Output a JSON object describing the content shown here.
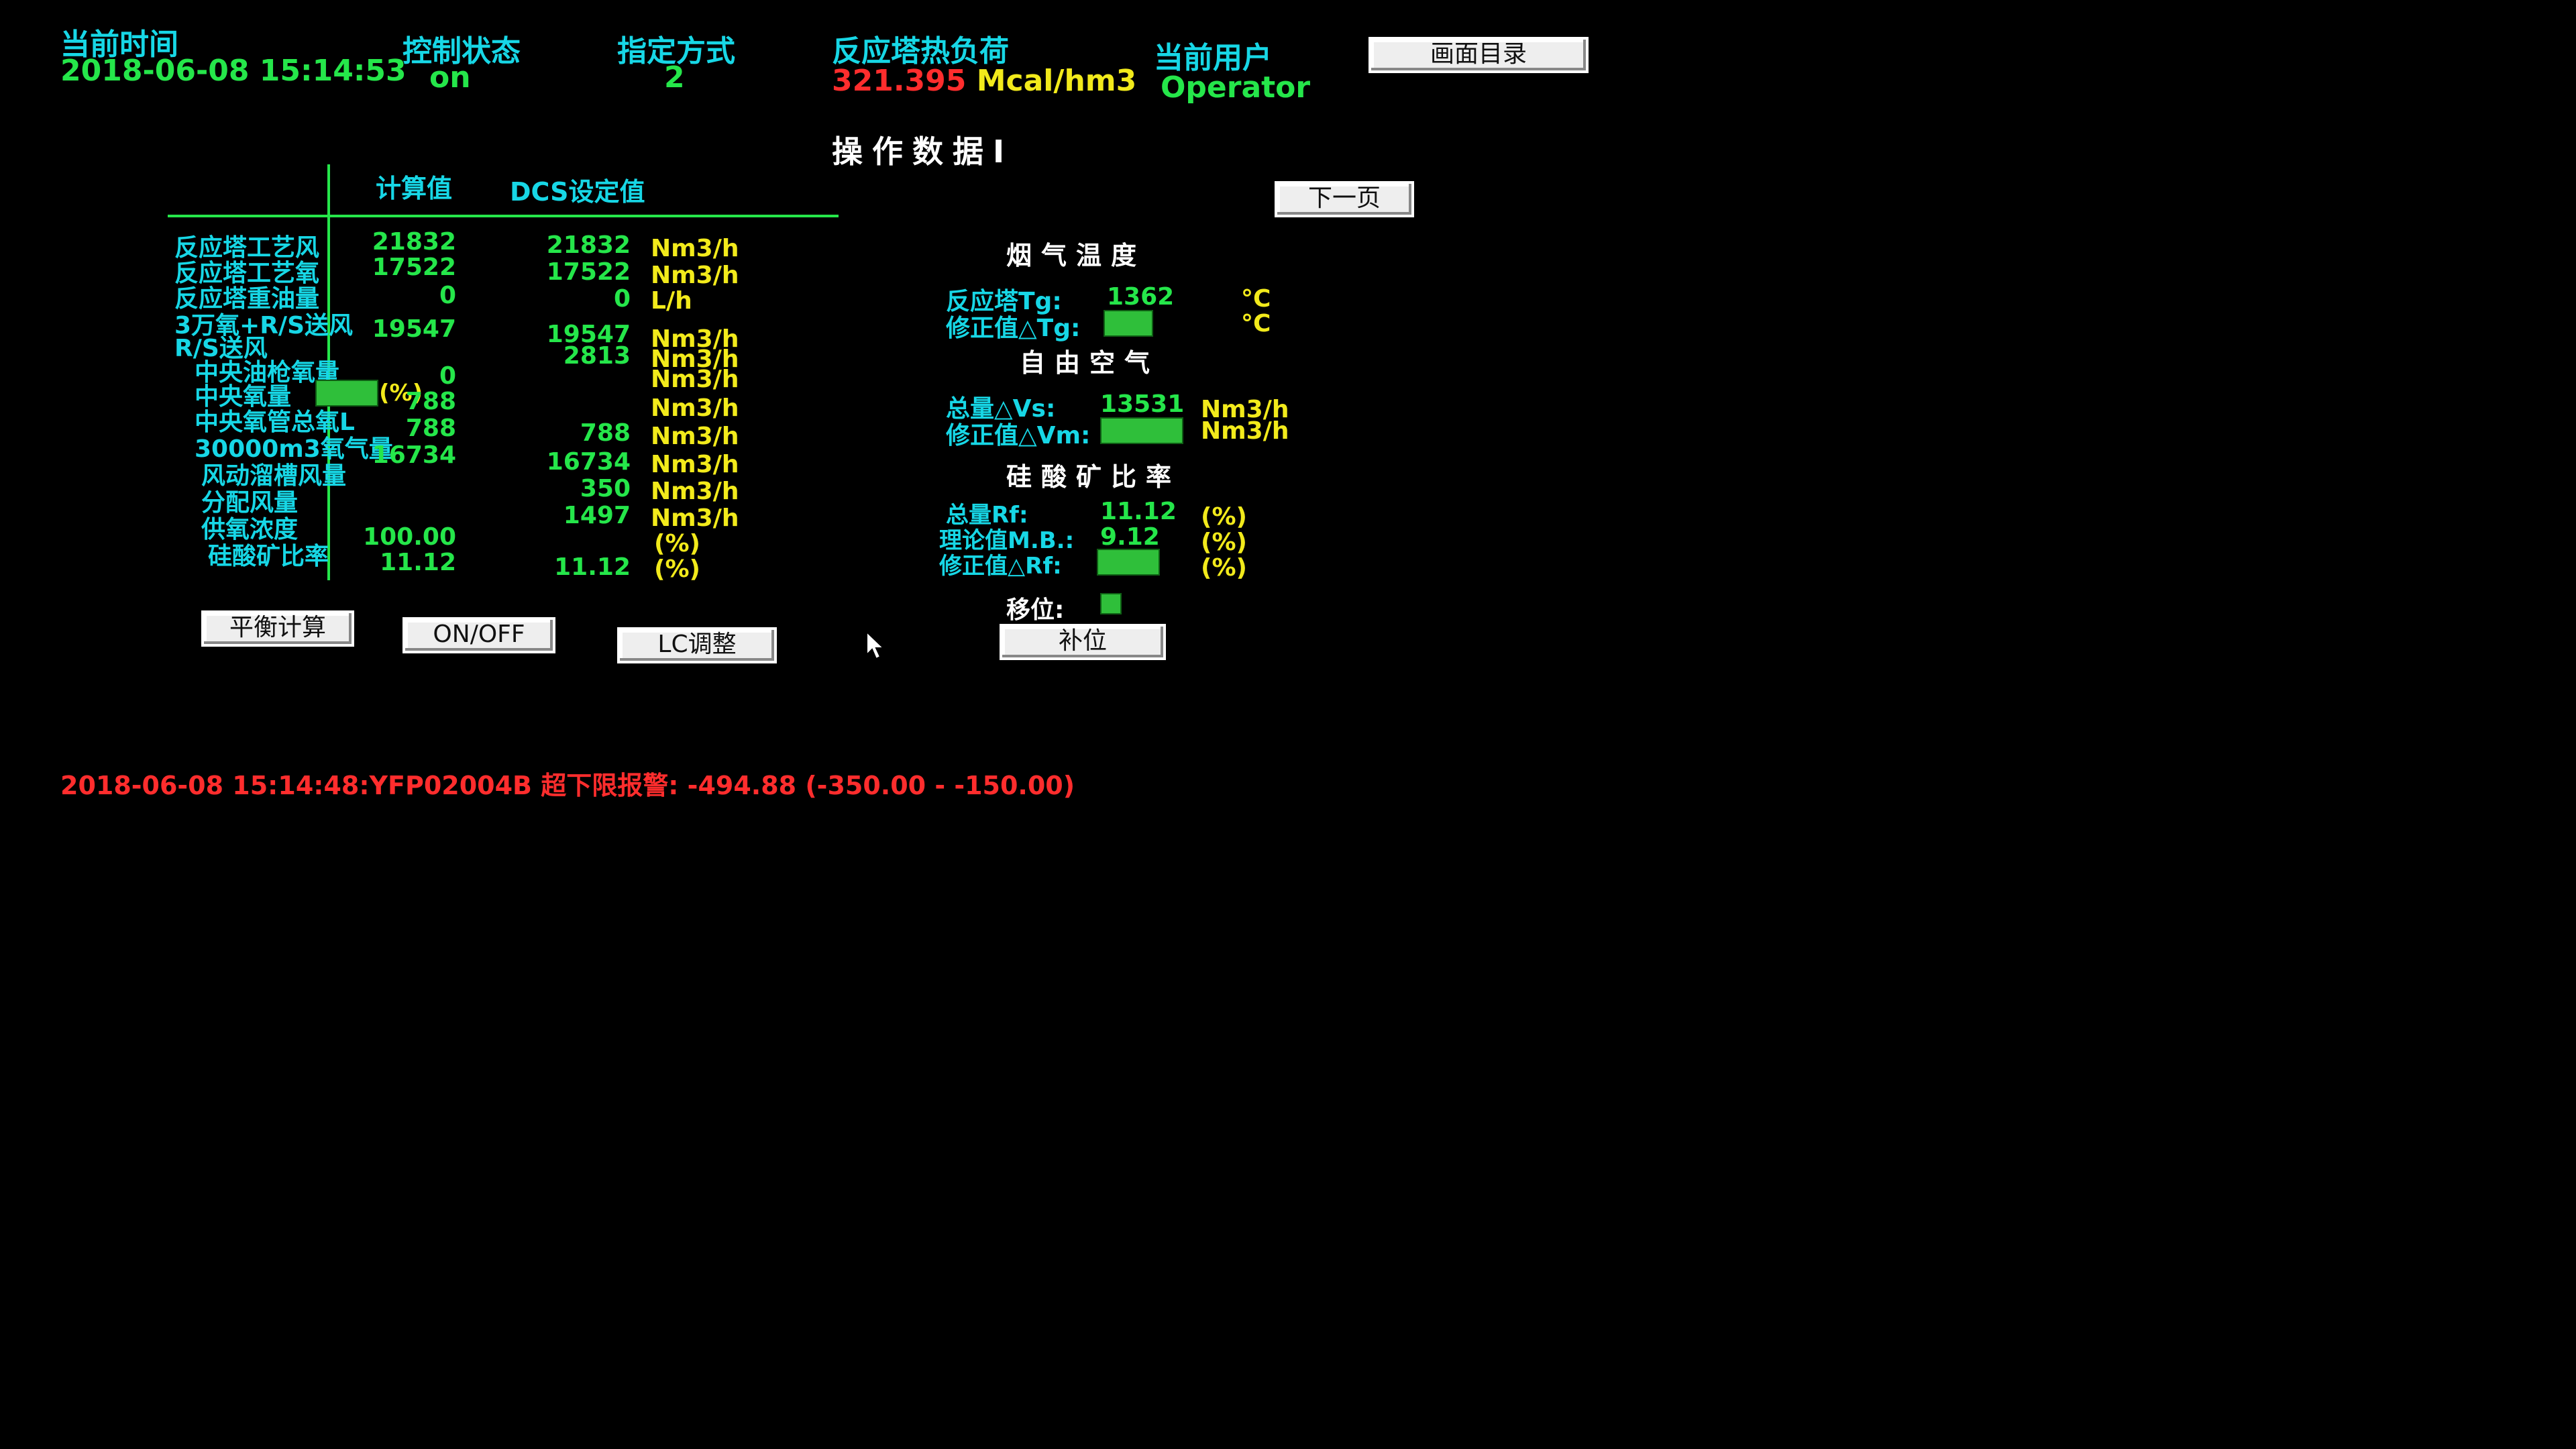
{
  "header": {
    "current_time_label": "当前时间",
    "current_time_value": "2018-06-08 15:14:53",
    "control_status_label": "控制状态",
    "control_status_value": "on",
    "mode_label": "指定方式",
    "mode_value": "2",
    "heat_load_label": "反应塔热负荷",
    "heat_load_value": "321.395",
    "heat_load_unit": "Mcal/hm3",
    "user_label": "当前用户",
    "user_value": "Operator",
    "menu_button": "画面目录"
  },
  "page_title": "操作数据I",
  "next_page_button": "下一页",
  "table": {
    "col_calc": "计算值",
    "col_dcs": "DCS设定值",
    "rows": [
      {
        "label": "反应塔工艺风",
        "calc": "21832",
        "dcs": "21832",
        "unit": "Nm3/h"
      },
      {
        "label": "反应塔工艺氧",
        "calc": "17522",
        "dcs": "17522",
        "unit": "Nm3/h"
      },
      {
        "label": "反应塔重油量",
        "calc": "0",
        "dcs": "0",
        "unit": "L/h"
      },
      {
        "label": "3万氧+R/S送风",
        "calc": "19547",
        "dcs": "19547",
        "unit": "Nm3/h"
      },
      {
        "label": "R/S送风",
        "calc": "",
        "dcs": "2813",
        "unit": "Nm3/h"
      },
      {
        "label": "中央油枪氧量",
        "calc": "0",
        "dcs": "",
        "unit": "Nm3/h"
      },
      {
        "label": "中央氧量",
        "calc": "788",
        "dcs": "",
        "unit": "Nm3/h"
      },
      {
        "label": "中央氧管总氧L",
        "calc": "788",
        "dcs": "788",
        "unit": "Nm3/h"
      },
      {
        "label": "30000m3氧气量",
        "calc": "16734",
        "dcs": "16734",
        "unit": "Nm3/h"
      },
      {
        "label": "风动溜槽风量",
        "calc": "",
        "dcs": "350",
        "unit": "Nm3/h"
      },
      {
        "label": "分配风量",
        "calc": "",
        "dcs": "1497",
        "unit": "Nm3/h"
      },
      {
        "label": "供氧浓度",
        "calc": "100.00",
        "dcs": "",
        "unit": "(%)"
      },
      {
        "label": "硅酸矿比率",
        "calc": "11.12",
        "dcs": "11.12",
        "unit": "(%)"
      }
    ],
    "center_oxygen_pct_unit": "(%)"
  },
  "buttons": {
    "balance_calc": "平衡计算",
    "on_off": "ON/OFF",
    "lc_adjust": "LC调整",
    "bias_reset": "补位"
  },
  "flue_gas": {
    "title": "烟气温度",
    "tg_label": "反应塔Tg:",
    "tg_value": "1362",
    "tg_unit": "°C",
    "tg_corr_label": "修正值△Tg:",
    "tg_corr_unit": "°C"
  },
  "free_air": {
    "title": "自由空气",
    "vs_label": "总量△Vs:",
    "vs_value": "13531",
    "vs_unit": "Nm3/h",
    "vm_label": "修正值△Vm:",
    "vm_unit": "Nm3/h"
  },
  "silicate": {
    "title": "硅酸矿比率",
    "rf_label": "总量Rf:",
    "rf_value": "11.12",
    "rf_unit": "(%)",
    "mb_label": "理论值M.B.:",
    "mb_value": "9.12",
    "mb_unit": "(%)",
    "rf_corr_label": "修正值△Rf:",
    "rf_corr_unit": "(%)"
  },
  "shift_label": "移位:",
  "alarm": "2018-06-08 15:14:48:YFP02004B 超下限报警: -494.88 (-350.00 - -150.00)",
  "colors": {
    "label": "#17d7e6",
    "value": "#25e64a",
    "unit": "#f2ea1b",
    "alarm": "#ff2d2d",
    "background": "#000000"
  }
}
